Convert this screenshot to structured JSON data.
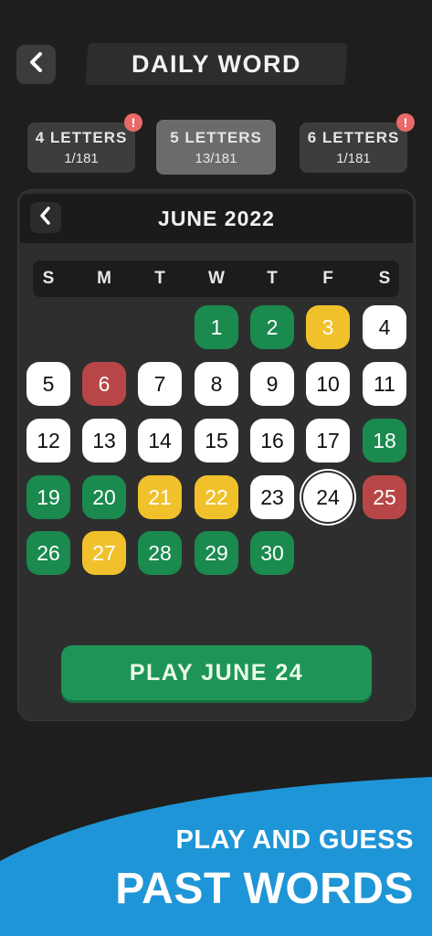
{
  "header": {
    "back_icon": "chevron-left-icon",
    "title": "DAILY WORD"
  },
  "tabs": [
    {
      "label": "4 LETTERS",
      "progress": "1/181",
      "badge": "!",
      "active": false
    },
    {
      "label": "5 LETTERS",
      "progress": "13/181",
      "badge": "",
      "active": true
    },
    {
      "label": "6 LETTERS",
      "progress": "1/181",
      "badge": "!",
      "active": false
    }
  ],
  "calendar": {
    "month_title": "JUNE 2022",
    "prev_icon": "chevron-left-icon",
    "weekdays": [
      "S",
      "M",
      "T",
      "W",
      "T",
      "F",
      "S"
    ],
    "days": [
      {
        "day": "1",
        "status": "green"
      },
      {
        "day": "2",
        "status": "green"
      },
      {
        "day": "3",
        "status": "yellow"
      },
      {
        "day": "4",
        "status": "white"
      },
      {
        "day": "5",
        "status": "white"
      },
      {
        "day": "6",
        "status": "red"
      },
      {
        "day": "7",
        "status": "white"
      },
      {
        "day": "8",
        "status": "white"
      },
      {
        "day": "9",
        "status": "white"
      },
      {
        "day": "10",
        "status": "white"
      },
      {
        "day": "11",
        "status": "white"
      },
      {
        "day": "12",
        "status": "white"
      },
      {
        "day": "13",
        "status": "white"
      },
      {
        "day": "14",
        "status": "white"
      },
      {
        "day": "15",
        "status": "white"
      },
      {
        "day": "16",
        "status": "white"
      },
      {
        "day": "17",
        "status": "white"
      },
      {
        "day": "18",
        "status": "green"
      },
      {
        "day": "19",
        "status": "green"
      },
      {
        "day": "20",
        "status": "green"
      },
      {
        "day": "21",
        "status": "yellow"
      },
      {
        "day": "22",
        "status": "yellow"
      },
      {
        "day": "23",
        "status": "white"
      },
      {
        "day": "24",
        "status": "selected"
      },
      {
        "day": "25",
        "status": "red"
      },
      {
        "day": "26",
        "status": "green"
      },
      {
        "day": "27",
        "status": "yellow"
      },
      {
        "day": "28",
        "status": "green"
      },
      {
        "day": "29",
        "status": "green"
      },
      {
        "day": "30",
        "status": "green"
      }
    ]
  },
  "play_button": {
    "label": "PLAY JUNE 24"
  },
  "promo": {
    "line1": "PLAY AND GUESS",
    "line2": "PAST WORDS"
  },
  "colors": {
    "background": "#1e1e1e",
    "green": "#1a8a4f",
    "yellow": "#f1c12c",
    "red": "#b94646",
    "promo_blue": "#1e95d6"
  }
}
